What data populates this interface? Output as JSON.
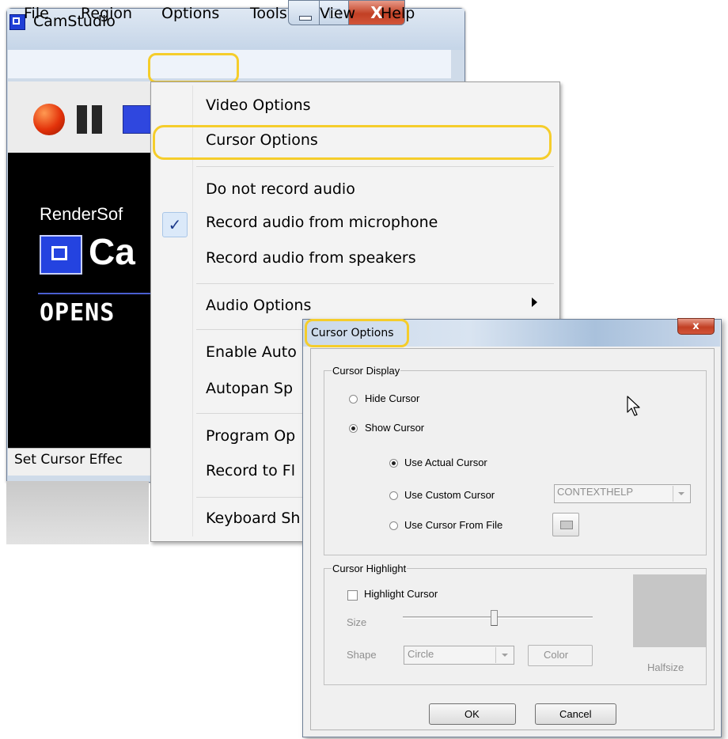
{
  "main_window": {
    "title": "CamStudio",
    "close_glyph": "X",
    "menu": [
      "File",
      "Region",
      "Options",
      "Tools",
      "View",
      "Help"
    ],
    "toolbar_icons": [
      "record-icon",
      "pause-icon",
      "stop-icon"
    ],
    "preview": {
      "brand": "RenderSof",
      "logo_text": "Ca",
      "subtitle": "OPENS"
    },
    "status": "Set Cursor Effec"
  },
  "options_menu": {
    "items": [
      "Video Options",
      "Cursor Options",
      "Do not record audio",
      "Record audio from microphone",
      "Record audio from speakers",
      "Audio Options",
      "Enable Auto",
      "Autopan Sp",
      "Program Op",
      "Record to Fl",
      "Keyboard Sh"
    ],
    "checked_item": "Record audio from microphone",
    "check_glyph": "✓",
    "submenu_item": "Audio Options"
  },
  "cursor_dialog": {
    "title": "Cursor Options",
    "close_glyph": "x",
    "display_group": {
      "label": "Cursor Display",
      "hide": "Hide Cursor",
      "show": "Show Cursor",
      "selected": "Show Cursor",
      "actual": "Use Actual Cursor",
      "custom": "Use Custom Cursor",
      "from_file": "Use Cursor From File",
      "selected_source": "Use Actual Cursor",
      "custom_cursor_value": "CONTEXTHELP"
    },
    "highlight_group": {
      "label": "Cursor Highlight",
      "checkbox": "Highlight Cursor",
      "checked": false,
      "size_label": "Size",
      "size_level": 0.48,
      "shape_label": "Shape",
      "shape_value": "Circle",
      "color_button": "Color",
      "preview_label": "Halfsize"
    },
    "buttons": {
      "ok": "OK",
      "cancel": "Cancel"
    }
  },
  "colors": {
    "highlight_ring": "#f5cd2b",
    "close_red": "#c24024",
    "record_red": "#e3320a",
    "stop_blue": "#2f47df"
  }
}
